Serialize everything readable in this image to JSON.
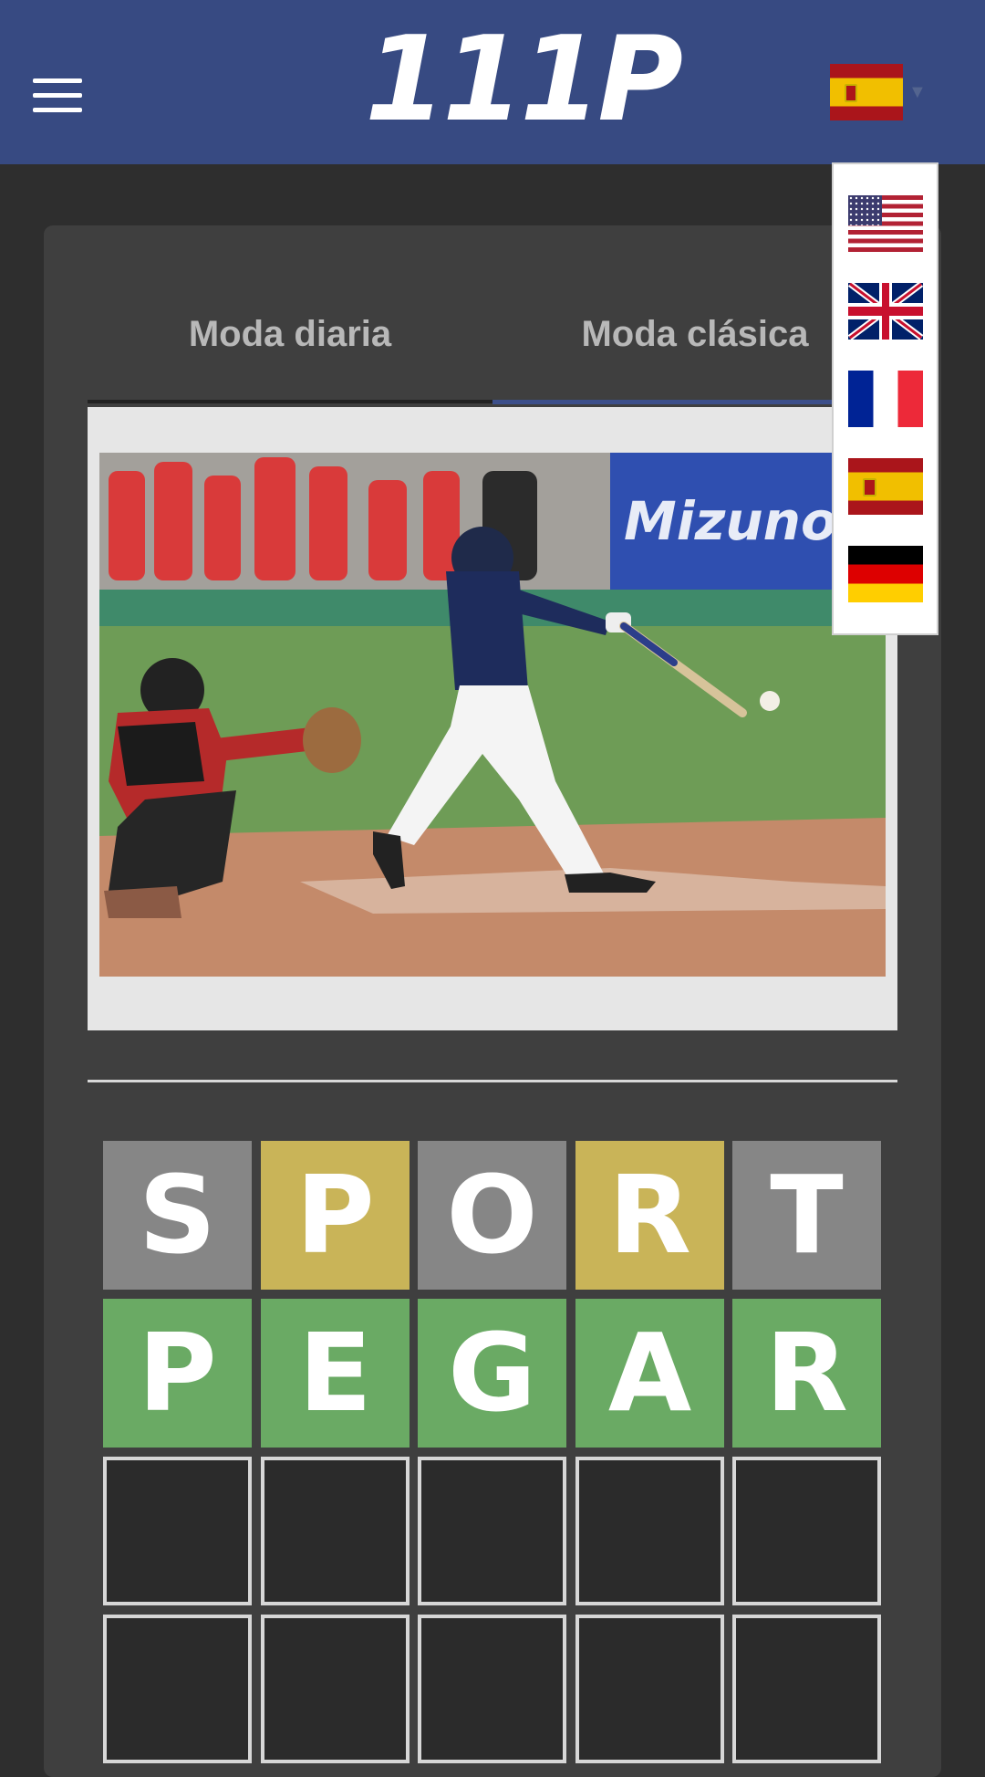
{
  "header": {
    "logo_text": "111P",
    "menu_icon": "hamburger-menu-icon",
    "current_language_flag": "spain-flag-icon",
    "dropdown_icon": "caret-down-icon",
    "background_color": "#374a82"
  },
  "language_menu": {
    "items": [
      {
        "flag_icon": "usa-flag-icon"
      },
      {
        "flag_icon": "uk-flag-icon"
      },
      {
        "flag_icon": "france-flag-icon"
      },
      {
        "flag_icon": "spain-flag-icon"
      },
      {
        "flag_icon": "germany-flag-icon"
      }
    ]
  },
  "tabs": {
    "daily_label": "Moda diaria",
    "classic_label": "Moda clásica",
    "active": "Moda clásica"
  },
  "clue_image": {
    "description_icon": "baseball-batter-photo",
    "banner_text": "Mizuno"
  },
  "board": {
    "rows": [
      {
        "letters": [
          "S",
          "P",
          "O",
          "R",
          "T"
        ],
        "states": [
          "absent",
          "present",
          "absent",
          "present",
          "absent"
        ]
      },
      {
        "letters": [
          "P",
          "E",
          "G",
          "A",
          "R"
        ],
        "states": [
          "correct",
          "correct",
          "correct",
          "correct",
          "correct"
        ]
      },
      {
        "letters": [
          "",
          "",
          "",
          "",
          ""
        ],
        "states": [
          "empty",
          "empty",
          "empty",
          "empty",
          "empty"
        ]
      },
      {
        "letters": [
          "",
          "",
          "",
          "",
          ""
        ],
        "states": [
          "empty",
          "empty",
          "empty",
          "empty",
          "empty"
        ]
      }
    ],
    "colors": {
      "absent": "#868686",
      "present": "#c9b458",
      "correct": "#6aaa64"
    }
  }
}
